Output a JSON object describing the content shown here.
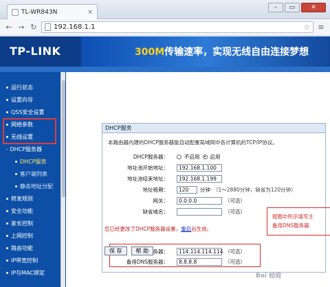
{
  "browser": {
    "tab_title": "TL-WR843N",
    "tab_close": "×",
    "window_controls": [
      "–",
      "▭",
      "✕"
    ],
    "address": "192.168.1.1",
    "nav_icons": [
      "back-arrow-icon",
      "forward-arrow-icon",
      "reload-icon",
      "page-icon",
      "star-icon",
      "menu-icon"
    ]
  },
  "router": {
    "logo": "TP-LINK",
    "slogan_highlight": "300M",
    "slogan": "传输速率，实现无线自由连接梦想",
    "sidebar": [
      {
        "label": "运行状态",
        "level": 1
      },
      {
        "label": "设置向导",
        "level": 1
      },
      {
        "label": "QSS安全设置",
        "level": 1
      },
      {
        "label": "网络参数",
        "level": 1
      },
      {
        "label": "无线设置",
        "level": 1
      },
      {
        "label": "DHCP服务器",
        "level": 1,
        "prefix": "-"
      },
      {
        "label": "DHCP服务",
        "level": 2,
        "active": true
      },
      {
        "label": "客户端列表",
        "level": 2
      },
      {
        "label": "静态地址分配",
        "level": 2
      },
      {
        "label": "转发规则",
        "level": 1
      },
      {
        "label": "安全功能",
        "level": 1
      },
      {
        "label": "家长控制",
        "level": 1
      },
      {
        "label": "上网控制",
        "level": 1
      },
      {
        "label": "路由功能",
        "level": 1
      },
      {
        "label": "IP带宽控制",
        "level": 1
      },
      {
        "label": "IP与MAC绑定",
        "level": 1
      }
    ],
    "panel_title": "DHCP服务",
    "description": "本路由器内建的DHCP服务器能自动配置局域网中各计算机的TCP/IP协议。",
    "form": {
      "dhcp_label": "DHCP服务器：",
      "dhcp_options": [
        "不启用",
        "启用"
      ],
      "dhcp_selected": "启用",
      "start_label": "地址池开始地址：",
      "start_value": "192.168.1.100",
      "end_label": "地址池结束地址：",
      "end_value": "192.168.1.199",
      "lease_label": "地址租期：",
      "lease_value": "120",
      "lease_unit": "分钟",
      "lease_hint": "（1～2880分钟，缺省为120分钟）",
      "gateway_label": "网关：",
      "gateway_value": "0.0.0.0",
      "optional": "（可选）",
      "domain_label": "缺省域名：",
      "domain_value": "",
      "dns1_label": "主DNS服务器：",
      "dns1_value": "114.114.114.114",
      "dns2_label": "备用DNS服务器：",
      "dns2_value": "8.8.8.8"
    },
    "warning": "您已经更改了DHCP服务器设置，",
    "warning_link": "重启",
    "warning_tail": "后生效。",
    "save_label": "保 存",
    "help_label": "帮 助",
    "annotation_line1": "按图中所示填写主",
    "annotation_line2": "备用DNS服务器"
  },
  "watermark": "Bai 经验"
}
